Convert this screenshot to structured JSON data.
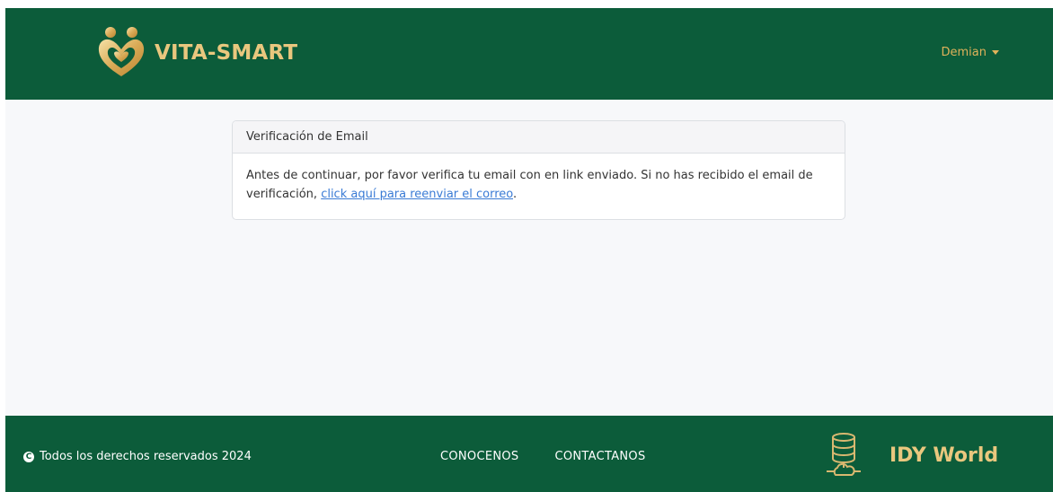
{
  "brand": {
    "name": "VITA-SMART",
    "logo_icon": "family-heart-icon"
  },
  "user": {
    "name": "Demian",
    "caret_icon": "caret-down-icon"
  },
  "card": {
    "header": "Verificación de Email",
    "body_text": "Antes de continuar, por favor verifica tu email con en link enviado. Si no has recibido el email de verificación,",
    "link_text": "click aquí para reenviar el correo",
    "trailing": "."
  },
  "footer": {
    "copyright": "Todos los derechos reservados 2024",
    "copyright_icon": "copyright-icon",
    "links": [
      "CONOCENOS",
      "CONTACTANOS"
    ],
    "partner_name": "IDY World",
    "partner_icon": "database-cloud-icon"
  },
  "colors": {
    "primary_green": "#0c5c3a",
    "gold": "#e9c77e",
    "link": "#3a7bd5",
    "background": "#f7f8fa"
  }
}
